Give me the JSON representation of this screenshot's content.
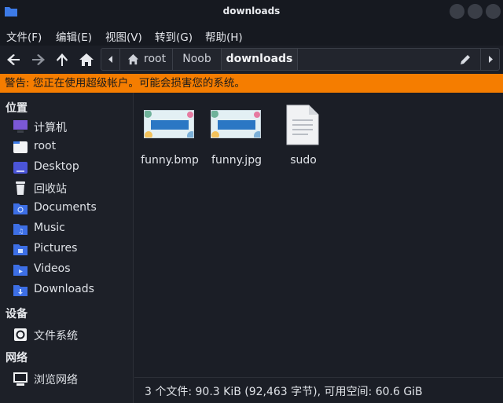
{
  "window": {
    "title": "downloads"
  },
  "menu": {
    "items": [
      "文件(F)",
      "编辑(E)",
      "视图(V)",
      "转到(G)",
      "帮助(H)"
    ]
  },
  "path": {
    "segments": [
      "root",
      "Noob",
      "downloads"
    ]
  },
  "warning": {
    "text": "警告: 您正在使用超级帐户。可能会损害您的系统。"
  },
  "sidebar": {
    "places_header": "位置",
    "places": [
      {
        "label": "计算机",
        "icon": "computer-icon"
      },
      {
        "label": "root",
        "icon": "home-folder-icon"
      },
      {
        "label": "Desktop",
        "icon": "desktop-folder-icon"
      },
      {
        "label": "回收站",
        "icon": "trash-icon"
      },
      {
        "label": "Documents",
        "icon": "documents-folder-icon"
      },
      {
        "label": "Music",
        "icon": "music-folder-icon"
      },
      {
        "label": "Pictures",
        "icon": "pictures-folder-icon"
      },
      {
        "label": "Videos",
        "icon": "videos-folder-icon"
      },
      {
        "label": "Downloads",
        "icon": "downloads-folder-icon"
      }
    ],
    "devices_header": "设备",
    "devices": [
      {
        "label": "文件系统",
        "icon": "drive-icon"
      }
    ],
    "network_header": "网络",
    "network": [
      {
        "label": "浏览网络",
        "icon": "network-icon"
      }
    ]
  },
  "files": [
    {
      "name": "funny.bmp",
      "type": "image"
    },
    {
      "name": "funny.jpg",
      "type": "image"
    },
    {
      "name": "sudo",
      "type": "document"
    }
  ],
  "status": {
    "text": "3 个文件: 90.3 KiB (92,463 字节), 可用空间: 60.6 GiB"
  },
  "colors": {
    "warning_bg": "#f57d00",
    "folder_blue": "#3d6fe6",
    "background": "#1b1e26"
  }
}
